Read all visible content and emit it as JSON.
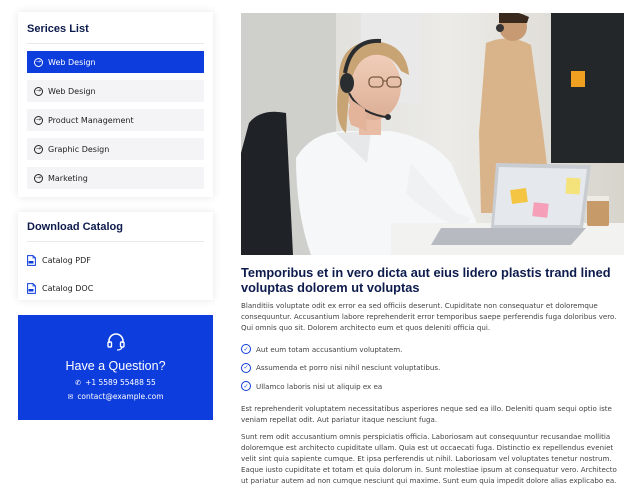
{
  "services": {
    "title": "Serices List",
    "items": [
      {
        "label": "Web Design",
        "active": true
      },
      {
        "label": "Web Design",
        "active": false
      },
      {
        "label": "Product Management",
        "active": false
      },
      {
        "label": "Graphic Design",
        "active": false
      },
      {
        "label": "Marketing",
        "active": false
      }
    ]
  },
  "catalog": {
    "title": "Download Catalog",
    "items": [
      {
        "label": "Catalog PDF"
      },
      {
        "label": "Catalog DOC"
      }
    ]
  },
  "help": {
    "title": "Have a Question?",
    "phone": "+1 5589 55488 55",
    "email": "contact@example.com"
  },
  "main": {
    "title": "Temporibus et in vero dicta aut eius lidero plastis trand lined voluptas dolorem ut voluptas",
    "intro": "Blanditiis voluptate odit ex error ea sed officiis deserunt. Cupiditate non consequatur et doloremque consequuntur. Accusantium labore reprehenderit error temporibus saepe perferendis fuga doloribus vero. Qui omnis quo sit. Dolorem architecto eum et quos deleniti officia qui.",
    "checks": [
      "Aut eum totam accusantium voluptatem.",
      "Assumenda et porro nisi nihil nesciunt voluptatibus.",
      "Ullamco laboris nisi ut aliquip ex ea"
    ],
    "para2": "Est reprehenderit voluptatem necessitatibus asperiores neque sed ea illo. Deleniti quam sequi optio iste veniam repellat odit. Aut pariatur itaque nesciunt fuga.",
    "para3": "Sunt rem odit accusantium omnis perspiciatis officia. Laboriosam aut consequuntur recusandae mollitia doloremque est architecto cupiditate ullam. Quia est ut occaecati fuga. Distinctio ex repellendus eveniet velit sint quia sapiente cumque. Et ipsa perferendis ut nihil. Laboriosam vel voluptates tenetur nostrum. Eaque iusto cupiditate et totam et quia dolorum in. Sunt molestiae ipsum at consequatur vero. Architecto ut pariatur autem ad non cumque nesciunt qui maxime. Sunt eum quia impedit dolore alias explicabo ea."
  }
}
